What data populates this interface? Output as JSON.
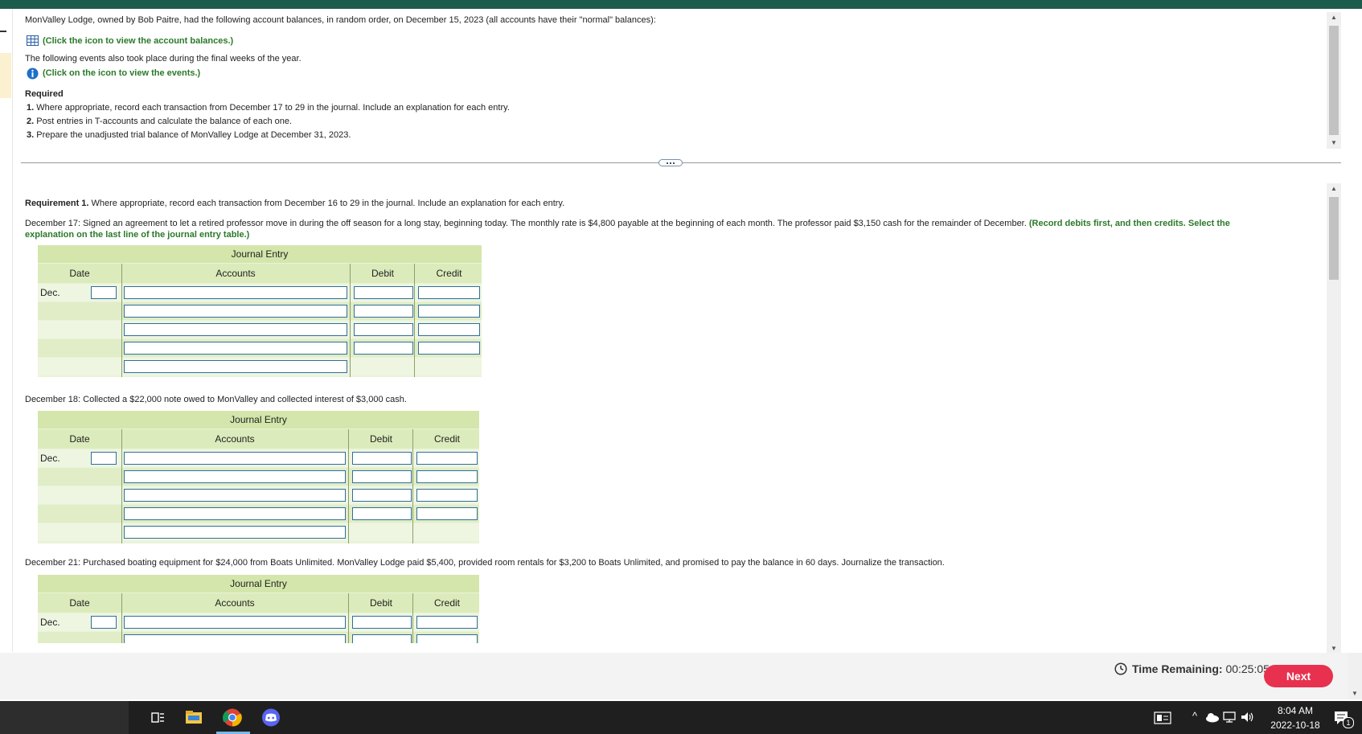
{
  "intro": {
    "text": "MonValley Lodge, owned by Bob Paitre, had the following account balances, in random order, on December 15, 2023 (all accounts have their \"normal\" balances):",
    "balances_link": "(Click the icon to view the account balances.)",
    "events_text": "The following events also took place during the final weeks of the year.",
    "events_link": "(Click on the icon to view the events.)"
  },
  "required": {
    "heading": "Required",
    "items": [
      {
        "num": "1.",
        "text": "Where appropriate, record each transaction from December 17 to 29 in the journal. Include an explanation for each entry."
      },
      {
        "num": "2.",
        "text": "Post entries in T-accounts and calculate the balance of each one."
      },
      {
        "num": "3.",
        "text": "Prepare the unadjusted trial balance of MonValley Lodge at December 31, 2023."
      }
    ]
  },
  "requirement1": {
    "label": "Requirement 1.",
    "text": " Where appropriate, record each transaction from December 16 to 29 in the journal. Include an explanation for each entry."
  },
  "transactions": [
    {
      "text": "December 17: Signed an agreement to let a retired professor move in during the off season for a long stay, beginning today. The monthly rate is $4,800 payable at the beginning of each month. The professor paid $3,150 cash for the remainder of December.",
      "instruction_a": "(Record debits first, and then credits. Select the",
      "instruction_b": "explanation on the last line of the journal entry table.)"
    },
    {
      "text": "December 18: Collected a $22,000 note owed to MonValley and collected interest of $3,000 cash."
    },
    {
      "text": "December 21: Purchased boating equipment for $24,000 from Boats Unlimited. MonValley Lodge paid $5,400, provided room rentals for $3,200 to Boats Unlimited, and promised to pay the balance in 60 days. Journalize the transaction."
    }
  ],
  "journal": {
    "title": "Journal Entry",
    "col_date": "Date",
    "col_accounts": "Accounts",
    "col_debit": "Debit",
    "col_credit": "Credit",
    "month": "Dec."
  },
  "footer": {
    "time_label": "Time Remaining:",
    "time_value": "00:25:05",
    "next_label": "Next"
  },
  "taskbar": {
    "time": "8:04 AM",
    "date": "2022-10-18",
    "notif_count": "1"
  }
}
